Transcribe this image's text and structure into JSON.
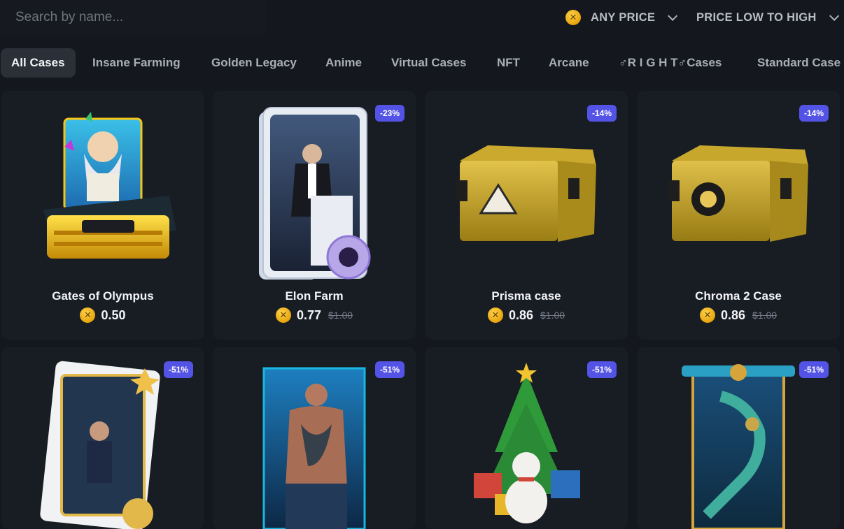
{
  "search": {
    "placeholder": "Search by name..."
  },
  "filters": {
    "price_filter": "ANY PRICE",
    "sort": "PRICE LOW TO HIGH"
  },
  "tabs": [
    "All Cases",
    "Insane Farming",
    "Golden Legacy",
    "Anime",
    "Virtual Cases",
    "NFT",
    "Arcane",
    "♂R I G H T♂Cases",
    "Standard Case"
  ],
  "cards": [
    {
      "name": "Gates of Olympus",
      "price": "0.50",
      "old_price": "",
      "badge": ""
    },
    {
      "name": "Elon Farm",
      "price": "0.77",
      "old_price": "$1.00",
      "badge": "-23%"
    },
    {
      "name": "Prisma case",
      "price": "0.86",
      "old_price": "$1.00",
      "badge": "-14%"
    },
    {
      "name": "Chroma 2 Case",
      "price": "0.86",
      "old_price": "$1.00",
      "badge": "-14%"
    },
    {
      "name": "",
      "price": "",
      "old_price": "",
      "badge": "-51%"
    },
    {
      "name": "",
      "price": "",
      "old_price": "",
      "badge": "-51%"
    },
    {
      "name": "",
      "price": "",
      "old_price": "",
      "badge": "-51%"
    },
    {
      "name": "",
      "price": "",
      "old_price": "",
      "badge": "-51%"
    }
  ],
  "colors": {
    "background": "#14171d",
    "card": "#181c23",
    "badge": "#5353e6",
    "coin": "#e6a40d"
  },
  "icons": {
    "coin": "coin-icon",
    "chevron": "chevron-down-icon"
  }
}
